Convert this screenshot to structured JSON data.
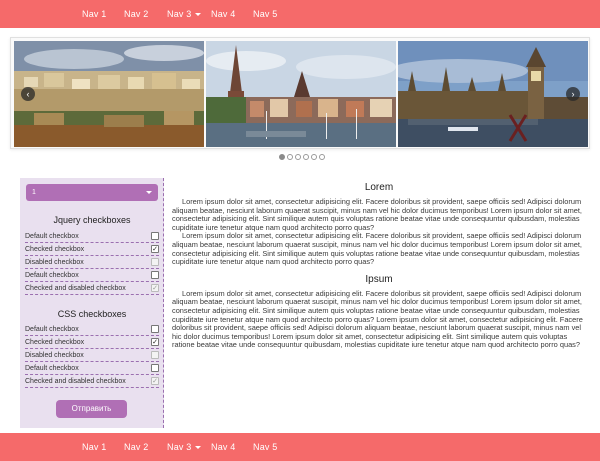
{
  "nav": {
    "items": [
      {
        "label": "Nav 1",
        "dropdown": false
      },
      {
        "label": "Nav 2",
        "dropdown": false
      },
      {
        "label": "Nav 3",
        "dropdown": true
      },
      {
        "label": "Nav 4",
        "dropdown": false
      },
      {
        "label": "Nav 5",
        "dropdown": false
      }
    ]
  },
  "carousel": {
    "prev_icon": "‹",
    "next_icon": "›",
    "slides": [
      "cityscape-photo",
      "church-harbor-photo",
      "parliament-big-ben-photo"
    ],
    "dots": 6,
    "active_dot": 0
  },
  "sidebar": {
    "select_value": "1",
    "jquery_title": "Jquery checkboxes",
    "css_title": "CSS checkboxes",
    "checkboxes": [
      {
        "label": "Default checkbox",
        "checked": false,
        "disabled": false
      },
      {
        "label": "Checked checkbox",
        "checked": true,
        "disabled": false
      },
      {
        "label": "Disabled checkbox",
        "checked": false,
        "disabled": true
      },
      {
        "label": "Default checkbox",
        "checked": false,
        "disabled": false
      },
      {
        "label": "Checked and disabled checkbox",
        "checked": true,
        "disabled": true
      }
    ],
    "submit_label": "Отправить"
  },
  "content": {
    "heading1": "Lorem",
    "p1": "Lorem ipsum dolor sit amet, consectetur adipisicing elit. Facere doloribus sit provident, saepe officiis sed! Adipisci dolorum aliquam beatae, nesciunt laborum quaerat suscipit, minus nam vel hic dolor ducimus temporibus! Lorem ipsum dolor sit amet, consectetur adipisicing elit. Sint similique autem quis voluptas ratione beatae vitae unde consequuntur quibusdam, molestias cupiditate iure tenetur atque nam quod architecto porro quas?",
    "p2": "Lorem ipsum dolor sit amet, consectetur adipisicing elit. Facere doloribus sit provident, saepe officiis sed! Adipisci dolorum aliquam beatae, nesciunt laborum quaerat suscipit, minus nam vel hic dolor ducimus temporibus! Lorem ipsum dolor sit amet, consectetur adipisicing elit. Sint similique autem quis voluptas ratione beatae vitae unde consequuntur quibusdam, molestias cupiditate iure tenetur atque nam quod architecto porro quas?",
    "heading2": "Ipsum",
    "p3": "Lorem ipsum dolor sit amet, consectetur adipisicing elit. Facere doloribus sit provident, saepe officiis sed! Adipisci dolorum aliquam beatae, nesciunt laborum quaerat suscipit, minus nam vel hic dolor ducimus temporibus! Lorem ipsum dolor sit amet, consectetur adipisicing elit. Sint similique autem quis voluptas ratione beatae vitae unde consequuntur quibusdam, molestias cupiditate iure tenetur atque nam quod architecto porro quas? Lorem ipsum dolor sit amet, consectetur adipisicing elit. Facere doloribus sit provident, saepe officiis sed! Adipisci dolorum aliquam beatae, nesciunt laborum quaerat suscipit, minus nam vel hic dolor ducimus temporibus! Lorem ipsum dolor sit amet, consectetur adipisicing elit. Sint similique autem quis voluptas ratione beatae vitae unde consequuntur quibusdam, molestias cupiditate iure tenetur atque nam quod architecto porro quas?"
  },
  "colors": {
    "navbar": "#f56a6a",
    "sidebar_bg": "#e9e0ef",
    "accent": "#b06fb5"
  }
}
